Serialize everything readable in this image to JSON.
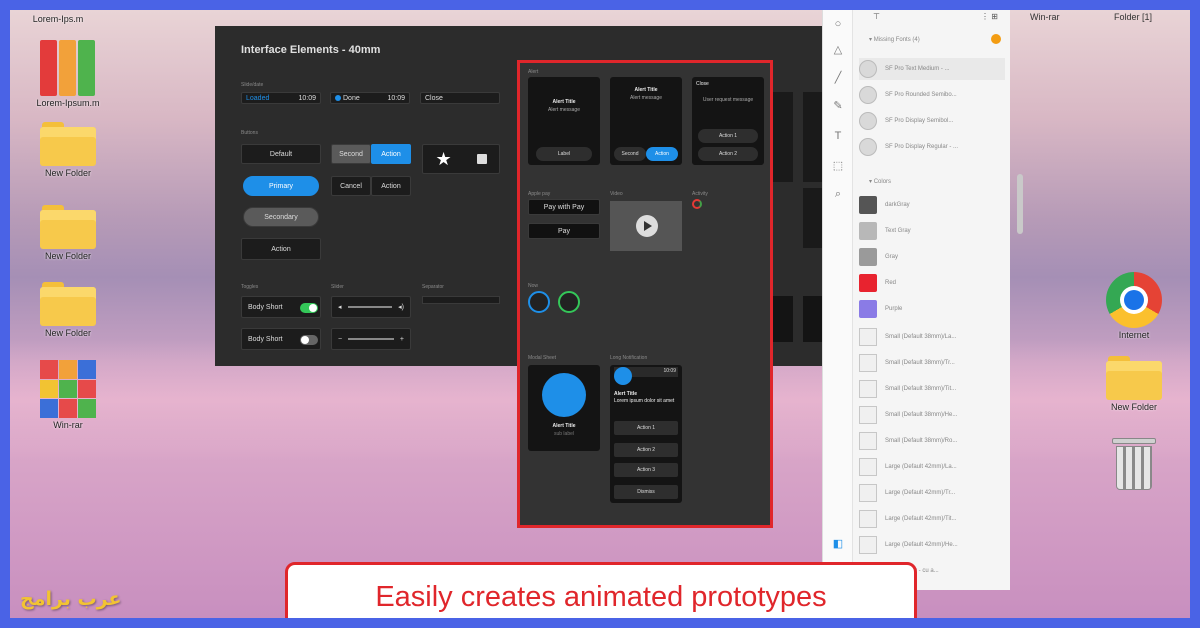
{
  "colors": {
    "accent_blue": "#1e8fe8",
    "highlight_red": "#e0262b",
    "frame_blue": "#4a63e6",
    "brand_yellow": "#f2c332"
  },
  "desktop_left": [
    {
      "label": "Lorem-Ips.m",
      "icon": "top-label"
    },
    {
      "label": "Lorem-Ipsum.m",
      "icon": "binders-icon"
    },
    {
      "label": "New Folder",
      "icon": "folder-icon"
    },
    {
      "label": "New Folder",
      "icon": "folder-icon"
    },
    {
      "label": "New Folder",
      "icon": "folder-icon"
    },
    {
      "label": "Win-rar",
      "icon": "winrar-icon"
    }
  ],
  "desktop_right": [
    {
      "label": "Internet",
      "icon": "chrome-icon"
    },
    {
      "label": "New Folder",
      "icon": "folder-icon"
    },
    {
      "label": "",
      "icon": "trash-icon"
    }
  ],
  "menubar": {
    "win_rar": "Win-rar",
    "folder": "Folder [1]"
  },
  "panel": {
    "title": "Interface Elements - 40mm",
    "input_row": {
      "field1_value": "Loaded",
      "field1_time": "10:09",
      "field2_label": "Done",
      "field2_time": "10:09",
      "field3_label": "Close"
    },
    "buttons": {
      "default": "Default",
      "second": "Second",
      "action_blue": "Action",
      "primary": "Primary",
      "cancel": "Cancel",
      "action": "Action",
      "secondary": "Secondary",
      "action_plain": "Action"
    },
    "toggles": [
      {
        "label": "Body Short",
        "on": true
      },
      {
        "label": "Body Short",
        "on": false
      }
    ]
  },
  "highlight": {
    "watch1": {
      "title": "Alert Title",
      "body": "Alert message",
      "btn": "Label"
    },
    "watch2": {
      "title": "Alert Title",
      "body": "Alert message",
      "btn_left": "Second",
      "btn_right": "Action"
    },
    "watch3": {
      "title": "Close",
      "body": "User request message",
      "btn1": "Action 1",
      "btn2": "Action 2"
    },
    "pay_btn": "Pay with  Pay",
    "pay_small": "Pay",
    "big_watch": {
      "title": "Alert Title",
      "sub": "sub label"
    },
    "list_watch": {
      "time": "10:09",
      "title": "Alert Title",
      "body": "Lorem ipsum dolor sit amet",
      "actions": [
        "Action 1",
        "Action 2",
        "Action 3"
      ],
      "dismiss": "Dismiss"
    }
  },
  "inspector": {
    "missing_fonts_header": "Missing Fonts (4)",
    "fonts": [
      "SF Pro Text Medium - ...",
      "SF Pro Rounded Semibo...",
      "SF Pro Display Semibol...",
      "SF Pro Display Regular - ..."
    ],
    "colors_header": "Colors",
    "colors": [
      {
        "name": "darkGray",
        "hex": "#555555"
      },
      {
        "name": "Text Gray",
        "hex": "#b8b8b8"
      },
      {
        "name": "Gray",
        "hex": "#9a9a9a"
      },
      {
        "name": "Red",
        "hex": "#e8232f"
      },
      {
        "name": "Purple",
        "hex": "#8a7be6"
      }
    ],
    "layouts": [
      "Small (Default 38mm)/La...",
      "Small (Default 38mm)/Tr...",
      "Small (Default 38mm)/Tit...",
      "Small (Default 38mm)/He...",
      "Small (Default 38mm)/Ro...",
      "Large (Default 42mm)/La...",
      "Large (Default 42mm)/Tr...",
      "Large (Default 42mm)/Tit...",
      "Large (Default 42mm)/He...",
      "AppPreview - cu a..."
    ]
  },
  "caption": "Easily creates animated prototypes",
  "brand": "عرب برامج"
}
